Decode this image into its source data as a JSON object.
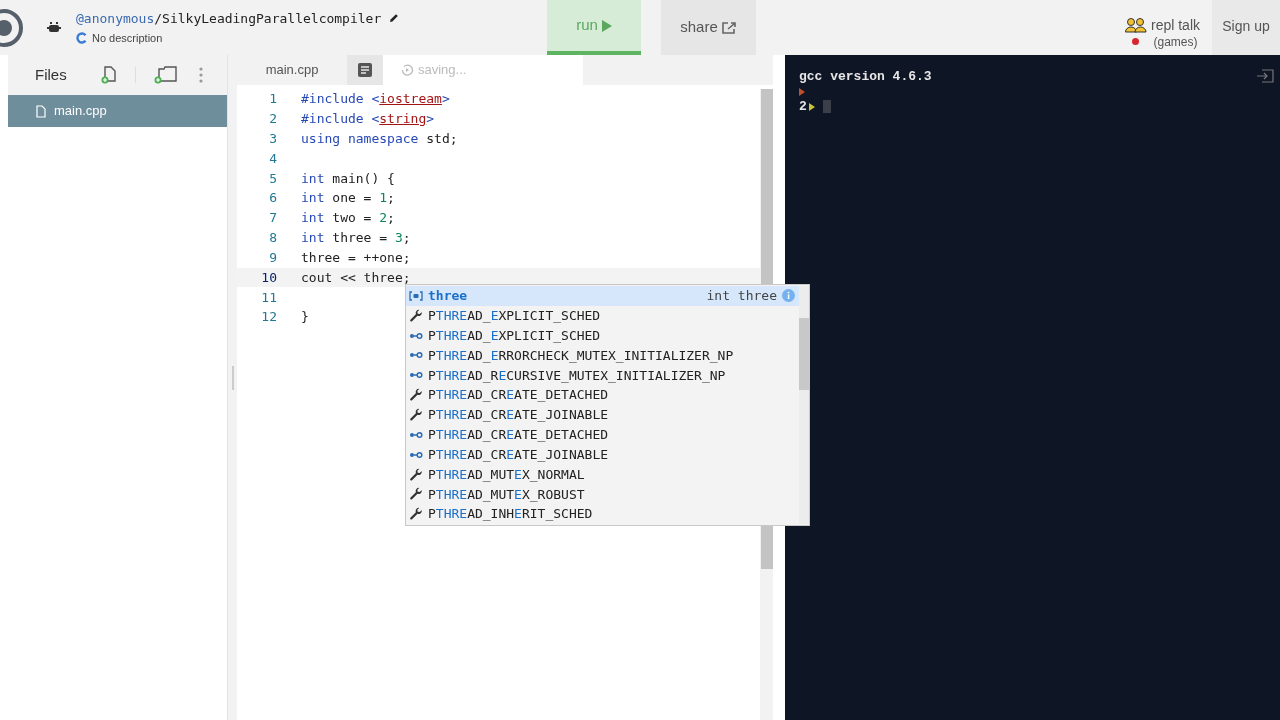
{
  "header": {
    "owner": "@anonymous",
    "repl_name": "/SilkyLeadingParallelcompiler",
    "description": "No description",
    "run": "run",
    "share": "share",
    "talk": "repl talk",
    "talk_sub": "(games)",
    "signup": "Sign up"
  },
  "files": {
    "title": "Files",
    "items": [
      {
        "name": "main.cpp",
        "selected": true
      }
    ]
  },
  "editor": {
    "tab": "main.cpp",
    "status": "saving...",
    "lines": [
      {
        "num": "1",
        "active": false,
        "tokens": [
          {
            "kind": "keyword",
            "text": "#include "
          },
          {
            "kind": "keyword",
            "text": "<"
          },
          {
            "kind": "string",
            "text": "iostream"
          },
          {
            "kind": "keyword",
            "text": ">"
          }
        ]
      },
      {
        "num": "2",
        "active": false,
        "tokens": [
          {
            "kind": "keyword",
            "text": "#include "
          },
          {
            "kind": "keyword",
            "text": "<"
          },
          {
            "kind": "string",
            "text": "string"
          },
          {
            "kind": "keyword",
            "text": ">"
          }
        ]
      },
      {
        "num": "3",
        "active": false,
        "tokens": [
          {
            "kind": "keyword",
            "text": "using namespace"
          },
          {
            "kind": "plain",
            "text": " std;"
          }
        ]
      },
      {
        "num": "4",
        "active": false
      },
      {
        "num": "5",
        "active": false,
        "tokens": [
          {
            "kind": "keyword",
            "text": "int"
          },
          {
            "kind": "plain",
            "text": " main() {"
          }
        ]
      },
      {
        "num": "6",
        "active": false,
        "tokens": [
          {
            "kind": "keyword",
            "text": "int"
          },
          {
            "kind": "plain",
            "text": " one = "
          },
          {
            "kind": "number",
            "text": "1"
          },
          {
            "kind": "plain",
            "text": ";"
          }
        ]
      },
      {
        "num": "7",
        "active": false,
        "tokens": [
          {
            "kind": "keyword",
            "text": "int"
          },
          {
            "kind": "plain",
            "text": " two = "
          },
          {
            "kind": "number",
            "text": "2"
          },
          {
            "kind": "plain",
            "text": ";"
          }
        ]
      },
      {
        "num": "8",
        "active": false,
        "tokens": [
          {
            "kind": "keyword",
            "text": "int"
          },
          {
            "kind": "plain",
            "text": " three = "
          },
          {
            "kind": "number",
            "text": "3"
          },
          {
            "kind": "plain",
            "text": ";"
          }
        ]
      },
      {
        "num": "9",
        "active": false,
        "tokens": [
          {
            "kind": "plain",
            "text": "three = ++one;"
          }
        ]
      },
      {
        "num": "10",
        "active": true,
        "tokens": [
          {
            "kind": "plain",
            "text": "cout << three;"
          }
        ]
      },
      {
        "num": "11",
        "active": false
      },
      {
        "num": "12",
        "active": false,
        "tokens": [
          {
            "kind": "plain",
            "text": "}"
          }
        ]
      }
    ]
  },
  "suggestions": {
    "detail": "int three",
    "items": [
      {
        "kind": "variable",
        "selected": true,
        "parts": [
          {
            "text": "three",
            "match": true
          }
        ]
      },
      {
        "kind": "wrench",
        "selected": false,
        "parts": [
          {
            "text": "P",
            "match": false
          },
          {
            "text": "THRE",
            "match": true
          },
          {
            "text": "AD_",
            "match": false
          },
          {
            "text": "E",
            "match": true
          },
          {
            "text": "XPLICIT_SCHED",
            "match": false
          }
        ]
      },
      {
        "kind": "constant",
        "selected": false,
        "parts": [
          {
            "text": "P",
            "match": false
          },
          {
            "text": "THRE",
            "match": true
          },
          {
            "text": "AD_",
            "match": false
          },
          {
            "text": "E",
            "match": true
          },
          {
            "text": "XPLICIT_SCHED",
            "match": false
          }
        ]
      },
      {
        "kind": "constant",
        "selected": false,
        "parts": [
          {
            "text": "P",
            "match": false
          },
          {
            "text": "THRE",
            "match": true
          },
          {
            "text": "AD_",
            "match": false
          },
          {
            "text": "E",
            "match": true
          },
          {
            "text": "RRORCHECK_MUTEX_INITIALIZER_NP",
            "match": false
          }
        ]
      },
      {
        "kind": "constant",
        "selected": false,
        "parts": [
          {
            "text": "P",
            "match": false
          },
          {
            "text": "THRE",
            "match": true
          },
          {
            "text": "AD_R",
            "match": false
          },
          {
            "text": "E",
            "match": true
          },
          {
            "text": "CURSIVE_MUTEX_INITIALIZER_NP",
            "match": false
          }
        ]
      },
      {
        "kind": "wrench",
        "selected": false,
        "parts": [
          {
            "text": "P",
            "match": false
          },
          {
            "text": "THRE",
            "match": true
          },
          {
            "text": "AD_CR",
            "match": false
          },
          {
            "text": "E",
            "match": true
          },
          {
            "text": "ATE_DETACHED",
            "match": false
          }
        ]
      },
      {
        "kind": "wrench",
        "selected": false,
        "parts": [
          {
            "text": "P",
            "match": false
          },
          {
            "text": "THRE",
            "match": true
          },
          {
            "text": "AD_CR",
            "match": false
          },
          {
            "text": "E",
            "match": true
          },
          {
            "text": "ATE_JOINABLE",
            "match": false
          }
        ]
      },
      {
        "kind": "constant",
        "selected": false,
        "parts": [
          {
            "text": "P",
            "match": false
          },
          {
            "text": "THRE",
            "match": true
          },
          {
            "text": "AD_CR",
            "match": false
          },
          {
            "text": "E",
            "match": true
          },
          {
            "text": "ATE_DETACHED",
            "match": false
          }
        ]
      },
      {
        "kind": "constant",
        "selected": false,
        "parts": [
          {
            "text": "P",
            "match": false
          },
          {
            "text": "THRE",
            "match": true
          },
          {
            "text": "AD_CR",
            "match": false
          },
          {
            "text": "E",
            "match": true
          },
          {
            "text": "ATE_JOINABLE",
            "match": false
          }
        ]
      },
      {
        "kind": "wrench",
        "selected": false,
        "parts": [
          {
            "text": "P",
            "match": false
          },
          {
            "text": "THRE",
            "match": true
          },
          {
            "text": "AD_MUT",
            "match": false
          },
          {
            "text": "E",
            "match": true
          },
          {
            "text": "X_NORMAL",
            "match": false
          }
        ]
      },
      {
        "kind": "wrench",
        "selected": false,
        "parts": [
          {
            "text": "P",
            "match": false
          },
          {
            "text": "THRE",
            "match": true
          },
          {
            "text": "AD_MUT",
            "match": false
          },
          {
            "text": "E",
            "match": true
          },
          {
            "text": "X_ROBUST",
            "match": false
          }
        ]
      },
      {
        "kind": "wrench",
        "selected": false,
        "parts": [
          {
            "text": "P",
            "match": false
          },
          {
            "text": "THRE",
            "match": true
          },
          {
            "text": "AD_INH",
            "match": false
          },
          {
            "text": "E",
            "match": true
          },
          {
            "text": "RIT_SCHED",
            "match": false
          }
        ]
      }
    ]
  },
  "console": {
    "lines": [
      {
        "kind": "output",
        "text": "gcc version 4.6.3"
      },
      {
        "kind": "prompt",
        "color": "#c0502a"
      },
      {
        "kind": "prompt",
        "text": "2",
        "color": "#c9c23a"
      }
    ]
  }
}
